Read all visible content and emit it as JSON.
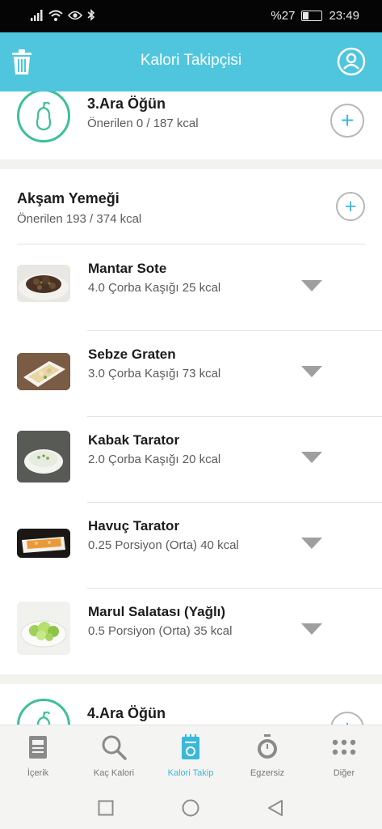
{
  "status": {
    "battery_text": "%27",
    "battery_level": 0.27,
    "time": "23:49"
  },
  "appbar": {
    "title": "Kalori Takipçisi",
    "icons": [
      "trash-icon",
      "profile-icon"
    ]
  },
  "snack3": {
    "title": "3.Ara Öğün",
    "subtitle": "Önerilen 0 / 187 kcal"
  },
  "dinner": {
    "title": "Akşam Yemeği",
    "subtitle": "Önerilen 193 / 374 kcal",
    "items": [
      {
        "name": "Mantar Sote",
        "detail": "4.0 Çorba Kaşığı 25 kcal"
      },
      {
        "name": "Sebze Graten",
        "detail": "3.0 Çorba Kaşığı 73 kcal"
      },
      {
        "name": "Kabak Tarator",
        "detail": "2.0 Çorba Kaşığı 20 kcal"
      },
      {
        "name": "Havuç Tarator",
        "detail": "0.25 Porsiyon (Orta) 40 kcal"
      },
      {
        "name": "Marul Salatası (Yağlı)",
        "detail": "0.5 Porsiyon (Orta) 35 kcal"
      }
    ]
  },
  "snack4": {
    "title": "4.Ara Öğün"
  },
  "nav": {
    "items": [
      {
        "label": "İçerik",
        "icon": "document-icon"
      },
      {
        "label": "Kaç Kalori",
        "icon": "search-icon"
      },
      {
        "label": "Kalori Takip",
        "icon": "tracker-icon"
      },
      {
        "label": "Egzersiz",
        "icon": "stopwatch-icon"
      },
      {
        "label": "Diğer",
        "icon": "more-icon"
      }
    ],
    "active_index": 2
  },
  "colors": {
    "accent": "#4fc6de",
    "pear_green": "#3dbf9a",
    "plus_blue": "#3bb8d8"
  }
}
